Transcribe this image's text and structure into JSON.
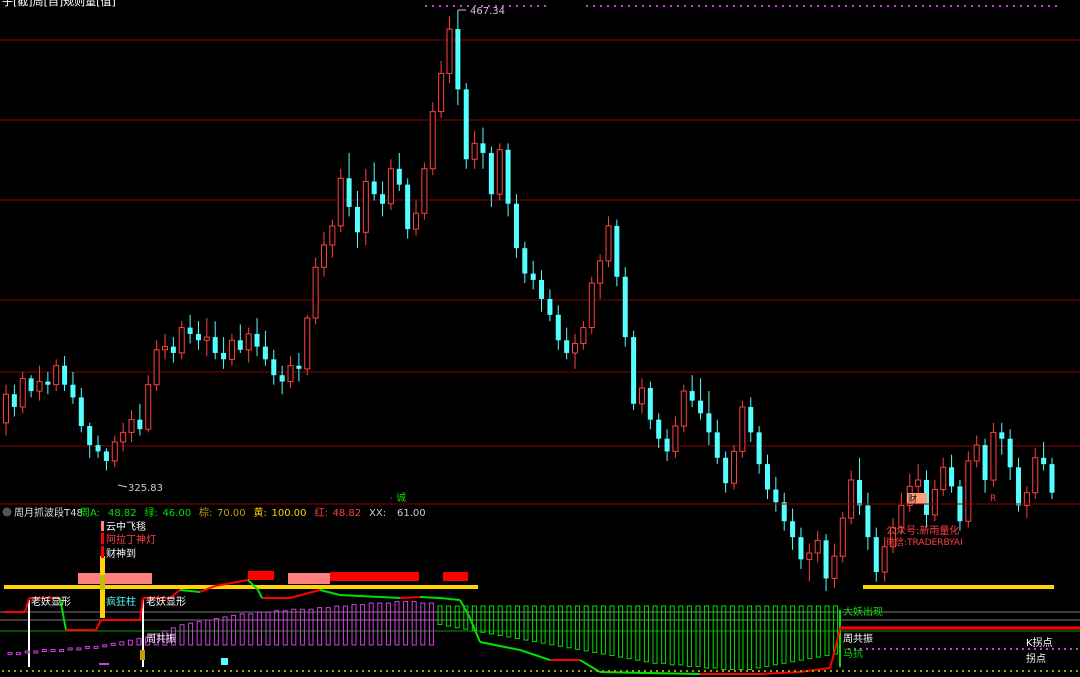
{
  "title_partial": "子[截]周[自]规则量[值]",
  "colors": {
    "up": "#ff4040",
    "down": "#54ffff",
    "grid": "#8b0000",
    "yellow": "#ffd200",
    "green": "#00e000",
    "red": "#ff0000",
    "pink": "#ff8080",
    "magenta": "#d040e0",
    "white": "#ffffff"
  },
  "chart_data": [
    {
      "type": "candlestick",
      "price_high_label": "467.34",
      "price_low_label": "325.83",
      "ylim": [
        322,
        470
      ],
      "candles": [
        [
          340,
          352,
          336,
          349
        ],
        [
          349,
          352,
          342,
          345
        ],
        [
          345,
          356,
          343,
          354
        ],
        [
          354,
          355,
          348,
          350
        ],
        [
          350,
          358,
          347,
          353
        ],
        [
          353,
          356,
          349,
          352
        ],
        [
          352,
          360,
          350,
          358
        ],
        [
          358,
          361,
          350,
          352
        ],
        [
          352,
          356,
          346,
          348
        ],
        [
          348,
          351,
          337,
          339
        ],
        [
          339,
          340,
          329,
          333
        ],
        [
          333,
          336,
          329,
          331
        ],
        [
          331,
          332,
          325,
          328
        ],
        [
          328,
          336,
          326,
          334
        ],
        [
          334,
          340,
          331,
          337
        ],
        [
          337,
          344,
          334,
          341
        ],
        [
          341,
          346,
          336,
          338
        ],
        [
          338,
          355,
          337,
          352
        ],
        [
          352,
          366,
          350,
          363
        ],
        [
          363,
          368,
          360,
          364
        ],
        [
          364,
          367,
          359,
          362
        ],
        [
          362,
          372,
          360,
          370
        ],
        [
          370,
          374,
          365,
          368
        ],
        [
          368,
          372,
          363,
          366
        ],
        [
          366,
          373,
          361,
          367
        ],
        [
          367,
          372,
          360,
          362
        ],
        [
          362,
          367,
          357,
          360
        ],
        [
          360,
          368,
          358,
          366
        ],
        [
          366,
          371,
          362,
          363
        ],
        [
          363,
          370,
          359,
          368
        ],
        [
          368,
          373,
          361,
          364
        ],
        [
          364,
          369,
          358,
          360
        ],
        [
          360,
          363,
          352,
          355
        ],
        [
          355,
          358,
          349,
          353
        ],
        [
          353,
          361,
          351,
          358
        ],
        [
          358,
          362,
          353,
          357
        ],
        [
          357,
          374,
          355,
          373
        ],
        [
          373,
          392,
          371,
          389
        ],
        [
          389,
          400,
          386,
          396
        ],
        [
          396,
          404,
          392,
          402
        ],
        [
          402,
          420,
          400,
          417
        ],
        [
          417,
          425,
          405,
          408
        ],
        [
          408,
          413,
          395,
          400
        ],
        [
          400,
          420,
          396,
          416
        ],
        [
          416,
          422,
          410,
          412
        ],
        [
          412,
          416,
          405,
          409
        ],
        [
          409,
          423,
          407,
          420
        ],
        [
          420,
          425,
          413,
          415
        ],
        [
          415,
          417,
          398,
          401
        ],
        [
          401,
          410,
          399,
          406
        ],
        [
          406,
          422,
          404,
          420
        ],
        [
          420,
          441,
          418,
          438
        ],
        [
          438,
          454,
          436,
          450
        ],
        [
          450,
          468,
          447,
          464
        ],
        [
          464,
          470,
          440,
          445
        ],
        [
          445,
          447,
          420,
          423
        ],
        [
          423,
          432,
          420,
          428
        ],
        [
          428,
          433,
          420,
          425
        ],
        [
          425,
          427,
          408,
          412
        ],
        [
          412,
          428,
          410,
          426
        ],
        [
          426,
          428,
          405,
          409
        ],
        [
          409,
          412,
          392,
          395
        ],
        [
          395,
          397,
          384,
          387
        ],
        [
          387,
          391,
          382,
          385
        ],
        [
          385,
          388,
          375,
          379
        ],
        [
          379,
          382,
          372,
          374
        ],
        [
          374,
          377,
          363,
          366
        ],
        [
          366,
          370,
          360,
          362
        ],
        [
          362,
          368,
          357,
          365
        ],
        [
          365,
          372,
          363,
          370
        ],
        [
          370,
          386,
          368,
          384
        ],
        [
          384,
          393,
          379,
          391
        ],
        [
          391,
          405,
          389,
          402
        ],
        [
          402,
          404,
          383,
          386
        ],
        [
          386,
          389,
          364,
          367
        ],
        [
          367,
          369,
          344,
          346
        ],
        [
          346,
          354,
          343,
          351
        ],
        [
          351,
          353,
          338,
          341
        ],
        [
          341,
          343,
          332,
          335
        ],
        [
          335,
          338,
          328,
          331
        ],
        [
          331,
          342,
          329,
          339
        ],
        [
          339,
          352,
          337,
          350
        ],
        [
          350,
          355,
          345,
          347
        ],
        [
          347,
          354,
          341,
          343
        ],
        [
          343,
          350,
          333,
          337
        ],
        [
          337,
          341,
          327,
          329
        ],
        [
          329,
          331,
          318,
          321
        ],
        [
          321,
          333,
          319,
          331
        ],
        [
          331,
          347,
          329,
          345
        ],
        [
          345,
          348,
          334,
          337
        ],
        [
          337,
          339,
          324,
          327
        ],
        [
          327,
          330,
          316,
          319
        ],
        [
          319,
          323,
          312,
          315
        ],
        [
          315,
          318,
          306,
          309
        ],
        [
          309,
          313,
          300,
          304
        ],
        [
          304,
          307,
          294,
          297
        ],
        [
          297,
          302,
          290,
          299
        ],
        [
          299,
          306,
          296,
          303
        ],
        [
          303,
          305,
          287,
          291
        ],
        [
          291,
          302,
          288,
          298
        ],
        [
          298,
          312,
          296,
          310
        ],
        [
          310,
          325,
          308,
          322
        ],
        [
          322,
          329,
          311,
          314
        ],
        [
          314,
          318,
          300,
          304
        ],
        [
          304,
          307,
          290,
          293
        ],
        [
          293,
          304,
          290,
          301
        ],
        [
          301,
          310,
          299,
          307
        ],
        [
          307,
          318,
          305,
          314
        ],
        [
          314,
          324,
          312,
          320
        ],
        [
          320,
          327,
          316,
          322
        ],
        [
          322,
          325,
          307,
          311
        ],
        [
          311,
          322,
          309,
          319
        ],
        [
          319,
          329,
          317,
          326
        ],
        [
          326,
          330,
          318,
          320
        ],
        [
          320,
          322,
          306,
          309
        ],
        [
          309,
          331,
          307,
          328
        ],
        [
          328,
          336,
          326,
          333
        ],
        [
          333,
          335,
          318,
          322
        ],
        [
          322,
          340,
          320,
          337
        ],
        [
          337,
          340,
          330,
          335
        ],
        [
          335,
          338,
          322,
          326
        ],
        [
          326,
          329,
          312,
          314
        ],
        [
          314,
          320,
          310,
          318
        ],
        [
          318,
          332,
          316,
          329
        ],
        [
          329,
          334,
          325,
          327
        ],
        [
          327,
          329,
          316,
          318
        ]
      ]
    },
    {
      "type": "indicator",
      "name": "周月抓波段T48",
      "legend": [
        {
          "label": "周A:",
          "value": "48.82",
          "color": "#00e000"
        },
        {
          "label": "绿:",
          "value": "46.00",
          "color": "#00e000"
        },
        {
          "label": "棕:",
          "value": "70.00",
          "color": "#c0a000"
        },
        {
          "label": "黄:",
          "value": "100.00",
          "color": "#ffd200"
        },
        {
          "label": "红:",
          "value": "48.82",
          "color": "#ff4040"
        },
        {
          "label": "XX:",
          "value": "61.00",
          "color": "#cccccc"
        }
      ],
      "bars_magenta": [
        38,
        38,
        39,
        39,
        40,
        40,
        40,
        41,
        41,
        42,
        42,
        43,
        44,
        45,
        46,
        47,
        48,
        50,
        52,
        54,
        56,
        57,
        58,
        59,
        60,
        61,
        62,
        63,
        63,
        64,
        64,
        65,
        65,
        66,
        66,
        66,
        67,
        67,
        68,
        68,
        69,
        69,
        70,
        70,
        70,
        71,
        71,
        71,
        70,
        70,
        69,
        68,
        67,
        66,
        65,
        64,
        63,
        62,
        61,
        60,
        59,
        58,
        57,
        56,
        55,
        54,
        53,
        52,
        51,
        50,
        49,
        48,
        47,
        46,
        45,
        44,
        44,
        43,
        43,
        42,
        42,
        41,
        41,
        40,
        40,
        40,
        40,
        41,
        42,
        43,
        44,
        45,
        46,
        47,
        48,
        49,
        50
      ],
      "annotations": [
        "云中飞毯",
        "阿拉丁神灯",
        "财神到",
        "老妖显形",
        "疯狂柱",
        "老妖显形",
        "周共振",
        "大妖出现",
        "周共振",
        "马抗",
        "K拐点",
        "拐点"
      ],
      "watermark": [
        "公众号:新雨量化",
        "微信:TRADERBYAI"
      ],
      "markers": [
        "诚",
        "财",
        "R"
      ]
    }
  ]
}
